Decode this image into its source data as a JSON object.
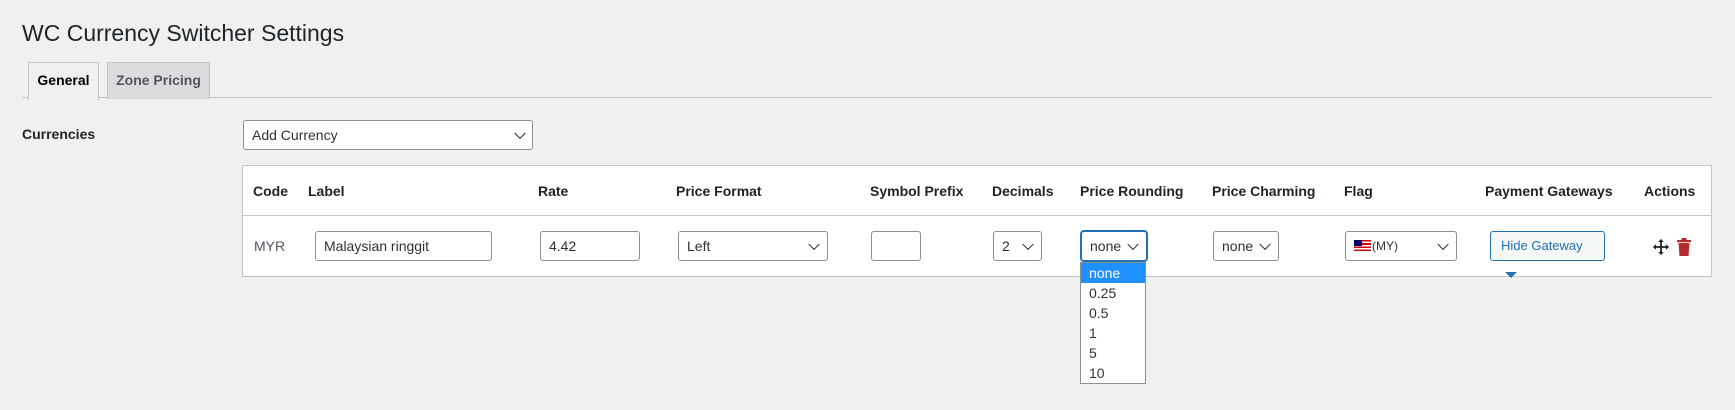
{
  "page": {
    "title": "WC Currency Switcher Settings"
  },
  "tabs": [
    {
      "label": "General",
      "active": true
    },
    {
      "label": "Zone Pricing",
      "active": false
    }
  ],
  "currencies": {
    "label": "Currencies",
    "add_currency": "Add Currency"
  },
  "table": {
    "headers": [
      "Code",
      "Label",
      "Rate",
      "Price Format",
      "Symbol Prefix",
      "Decimals",
      "Price Rounding",
      "Price Charming",
      "Flag",
      "Payment Gateways",
      "Actions"
    ],
    "row": {
      "code": "MYR",
      "label": "Malaysian ringgit",
      "rate": "4.42",
      "price_format": "Left",
      "symbol_prefix": "",
      "decimals": "2",
      "price_rounding": "none",
      "price_charming": "none",
      "flag": "(MY)",
      "payment_gateways": "Hide Gateway"
    }
  },
  "rounding_dropdown": {
    "options": [
      "none",
      "0.25",
      "0.5",
      "1",
      "5",
      "10"
    ],
    "selected": "none"
  },
  "colors": {
    "accent": "#2271b1",
    "highlight": "#1e90ff",
    "trash": "#b32d2e",
    "background": "#f0f0f1"
  }
}
